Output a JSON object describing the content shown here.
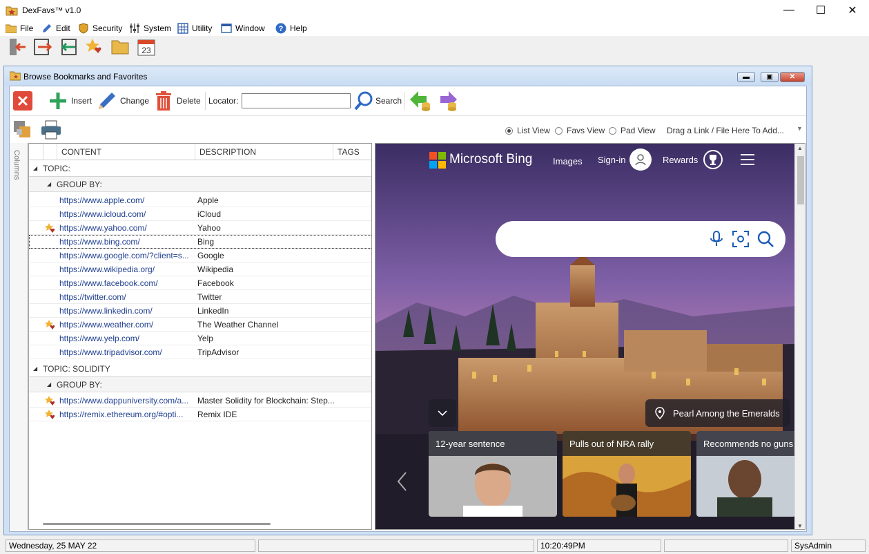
{
  "app": {
    "title": "DexFavs™ v1.0"
  },
  "window_controls": {
    "minimize": "—",
    "maximize": "☐",
    "close": "✕"
  },
  "menu": [
    {
      "label": "File",
      "icon": "folder-icon"
    },
    {
      "label": "Edit",
      "icon": "pencil-icon"
    },
    {
      "label": "Security",
      "icon": "shield-icon"
    },
    {
      "label": "System",
      "icon": "sliders-icon"
    },
    {
      "label": "Utility",
      "icon": "calculator-icon"
    },
    {
      "label": "Window",
      "icon": "window-icon"
    },
    {
      "label": "Help",
      "icon": "help-icon"
    }
  ],
  "main_toolbar": {
    "calendar_day": "23"
  },
  "child": {
    "title": "Browse Bookmarks and Favorites"
  },
  "toolbar": {
    "insert": "Insert",
    "change": "Change",
    "delete": "Delete",
    "locator_label": "Locator:",
    "locator_value": "",
    "search": "Search"
  },
  "view": {
    "list_view": "List View",
    "favs_view": "Favs View",
    "pad_view": "Pad View",
    "selected": "List View",
    "drag_hint": "Drag a Link / File Here To Add..."
  },
  "side_tab": "Columns",
  "grid": {
    "columns": [
      "CONTENT",
      "DESCRIPTION",
      "TAGS"
    ],
    "topic1": "TOPIC:",
    "group1": "GROUP BY:",
    "rows1": [
      {
        "url": "https://www.apple.com/",
        "desc": "Apple",
        "fav": false
      },
      {
        "url": "https://www.icloud.com/",
        "desc": "iCloud",
        "fav": false
      },
      {
        "url": "https://www.yahoo.com/",
        "desc": "Yahoo",
        "fav": true
      },
      {
        "url": "https://www.bing.com/",
        "desc": "Bing",
        "fav": false
      },
      {
        "url": "https://www.google.com/?client=s...",
        "desc": "Google",
        "fav": false
      },
      {
        "url": "https://www.wikipedia.org/",
        "desc": "Wikipedia",
        "fav": false
      },
      {
        "url": "https://www.facebook.com/",
        "desc": "Facebook",
        "fav": false
      },
      {
        "url": "https://twitter.com/",
        "desc": "Twitter",
        "fav": false
      },
      {
        "url": "https://www.linkedin.com/",
        "desc": "LinkedIn",
        "fav": false
      },
      {
        "url": "https://www.weather.com/",
        "desc": "The Weather Channel",
        "fav": true
      },
      {
        "url": "https://www.yelp.com/",
        "desc": "Yelp",
        "fav": false
      },
      {
        "url": "https://www.tripadvisor.com/",
        "desc": "TripAdvisor",
        "fav": false
      }
    ],
    "topic2": "TOPIC: SOLIDITY",
    "group2": "GROUP BY:",
    "rows2": [
      {
        "url": "https://www.dappuniversity.com/a...",
        "desc": "Master Solidity for Blockchain: Step...",
        "fav": true
      },
      {
        "url": "https://remix.ethereum.org/#opti...",
        "desc": "Remix IDE",
        "fav": true
      }
    ]
  },
  "browser": {
    "brand": "Microsoft Bing",
    "images": "Images",
    "signin": "Sign-in",
    "rewards": "Rewards",
    "location": "Pearl Among the Emeralds",
    "news": [
      "12-year sentence",
      "Pulls out of NRA rally",
      "Recommends no guns"
    ]
  },
  "status": {
    "date": "Wednesday, 25 MAY 22",
    "time": "10:20:49PM",
    "user": "SysAdmin"
  }
}
